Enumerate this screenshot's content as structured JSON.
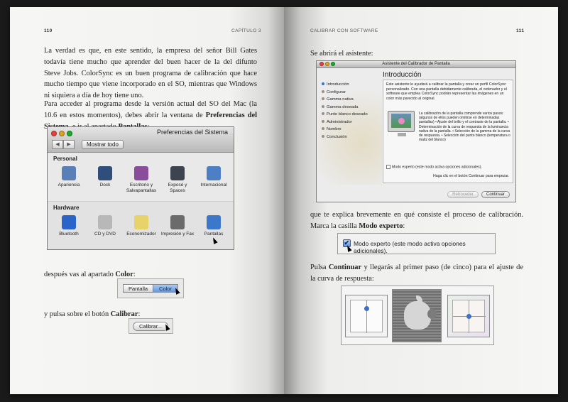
{
  "left_page": {
    "page_number": "110",
    "running_head": "CAPÍTULO 3",
    "para1": "La verdad es que, en este sentido, la empresa del señor Bill Gates todavía tiene mucho que aprender del buen hacer de la del difunto Steve Jobs. ColorSync es un buen programa de calibración que hace mucho tiempo que viene incorporado en el SO, mientras que Windows ni siquiera a día de hoy tiene uno.",
    "para2_a": "Para acceder al programa desde la versión actual del SO del Mac (la 10.6 en estos momentos), debes abrir la ventana de ",
    "para2_b": "Preferencias del Sistema",
    "para2_c": ", e ir al apartado ",
    "para2_d": "Pantallas",
    "para2_e": ":",
    "para3_a": "después vas al apartado ",
    "para3_b": "Color",
    "para3_c": ":",
    "para4_a": "y pulsa sobre el botón ",
    "para4_b": "Calibrar",
    "para4_c": ":"
  },
  "prefs_window": {
    "title": "Preferencias del Sistema",
    "back_label": "◀",
    "forward_label": "▶",
    "show_all": "Mostrar todo",
    "personal_title": "Personal",
    "personal": [
      {
        "label": "Apariencia",
        "color": "#5a7fb8"
      },
      {
        "label": "Dock",
        "color": "#2f4f7a"
      },
      {
        "label": "Escritorio y Salvapantallas",
        "color": "#8a4d9b"
      },
      {
        "label": "Exposé y Spaces",
        "color": "#3d4450"
      },
      {
        "label": "Internacional",
        "color": "#4d7fc4"
      }
    ],
    "hardware_title": "Hardware",
    "hardware": [
      {
        "label": "Bluetooth",
        "color": "#2a64c8"
      },
      {
        "label": "CD y DVD",
        "color": "#b8b8b8"
      },
      {
        "label": "Economizador",
        "color": "#e8d36a"
      },
      {
        "label": "Impresión y Fax",
        "color": "#6b6b6b"
      },
      {
        "label": "Pantallas",
        "color": "#3b78c9"
      }
    ]
  },
  "display_tabs": {
    "tab1": "Pantalla",
    "tab2": "Color"
  },
  "calibrate_button": "Calibrar...",
  "right_page": {
    "page_number": "111",
    "running_head": "CALIBRAR CON SOFTWARE",
    "para1": "Se abrirá el asistente:",
    "para2_a": "que te explica brevemente en qué consiste el proceso de calibración. Marca la casilla ",
    "para2_b": "Modo experto",
    "para2_c": ":",
    "para3_a": "Pulsa ",
    "para3_b": "Continuar",
    "para3_c": " y llegarás al primer paso (de cinco) para el ajuste de la curva de respuesta:"
  },
  "assistant": {
    "title": "Asistente del Calibrador de Pantalla",
    "heading": "Introducción",
    "steps": [
      {
        "label": "Introducción",
        "active": true
      },
      {
        "label": "Configurar",
        "active": false
      },
      {
        "label": "Gamma nativa",
        "active": false
      },
      {
        "label": "Gamma deseada",
        "active": false
      },
      {
        "label": "Punto blanco deseado",
        "active": false
      },
      {
        "label": "Administrador",
        "active": false
      },
      {
        "label": "Nombre",
        "active": false
      },
      {
        "label": "Conclusión",
        "active": false
      }
    ],
    "intro_text": "Este asistente le ayudará a calibrar la pantalla y crear un perfil ColorSync personalizado. Con una pantalla debidamente calibrada, el ordenador y el software que emplea ColorSync podrán representar las imágenes en un color más parecido al original.",
    "desc_text": "La calibración de la pantalla comprende varios pasos: (algunos de ellos pueden omitirse en determinadas pantallas) • Ajuste del brillo y el contraste de la pantalla. • Determinación de la curva de respuesta de la luminancia nativa de la pantalla. • Selección de la gamma de la curva de respuesta. • Selección del punto blanco (temperatura o matiz del blanco)",
    "expert_label": "Modo experto (este modo activa opciones adicionales).",
    "hint": "Haga clic en el botón Continuar para empezar.",
    "back_button": "Retroceder",
    "continue_button": "Continuar"
  },
  "expert_callout": {
    "check": "✔",
    "label": "Modo experto (este modo activa opciones adicionales)."
  }
}
